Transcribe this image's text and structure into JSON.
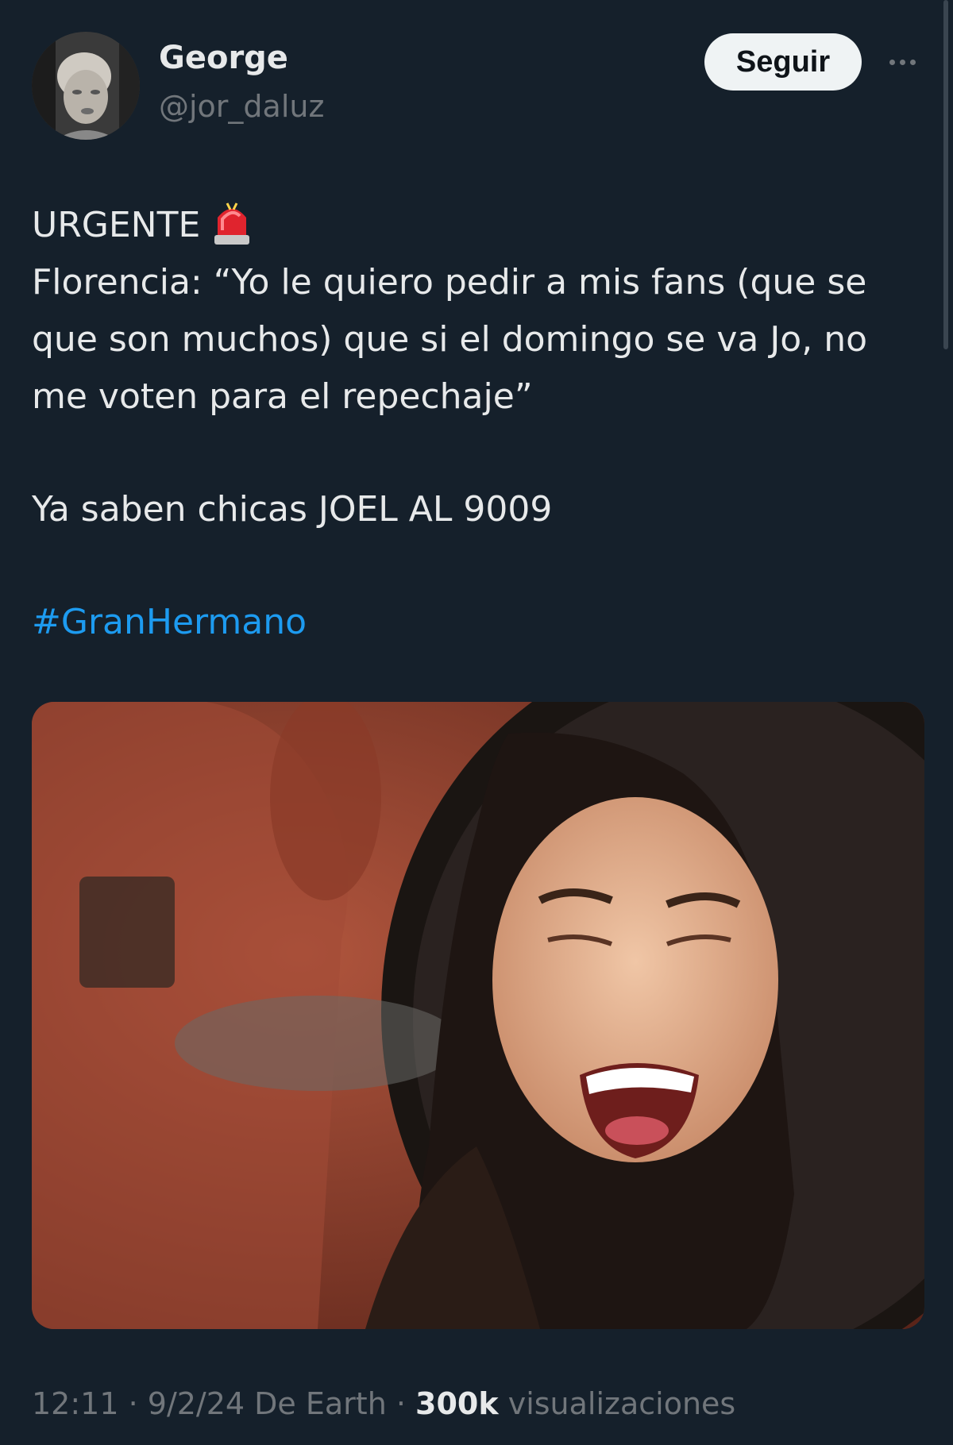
{
  "author": {
    "display_name": "George",
    "handle": "@jor_daluz",
    "avatar_icon": "profile-photo"
  },
  "follow_label": "Seguir",
  "more_icon": "ellipsis-icon",
  "tweet": {
    "line1": "URGENTE",
    "siren_icon": "police-siren-emoji",
    "line2": "Florencia: “Yo le quiero pedir a mis fans (que se",
    "line3": "que son muchos) que si el domingo se va Jo, no",
    "line4": "me voten para el repechaje”",
    "line5": "Ya saben chicas JOEL AL 9009",
    "hashtag": "#GranHermano"
  },
  "media": {
    "icon": "photo-laughing-woman"
  },
  "meta": {
    "time": "12:11",
    "sep1": " · ",
    "date": "9/2/24",
    "source": " De Earth",
    "sep2": " · ",
    "views_count": "300k",
    "views_label": " visualizaciones"
  },
  "colors": {
    "background": "#15202b",
    "text": "#e7e9ea",
    "secondary": "#71767b",
    "link": "#1d9bf0",
    "button_bg": "#eff3f4"
  }
}
